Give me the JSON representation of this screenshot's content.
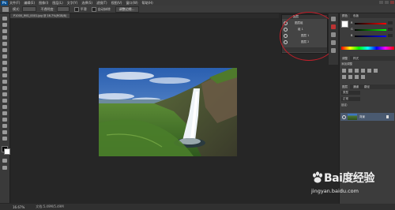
{
  "menubar": {
    "logo": "Ps",
    "items": [
      "文件(F)",
      "编辑(E)",
      "图像(I)",
      "图层(L)",
      "文字(Y)",
      "选择(S)",
      "滤镜(T)",
      "视图(V)",
      "窗口(W)",
      "帮助(H)"
    ]
  },
  "options": {
    "mode_label": "模式:",
    "mode_value": "正常",
    "opacity_label": "不透明度:",
    "opacity_value": "100%",
    "smooth_label": "平滑",
    "autoerase_label": "自动抹除",
    "button_label": "调整边缘..."
  },
  "document": {
    "tab_title": "P1000_IMG_0001.jpg @ 16.7%(RGB/8)",
    "zoom": "16.67%",
    "doc_info": "文档:5.49M/5.49M"
  },
  "flyout": {
    "tab_label": "图层",
    "rows": [
      "图层组",
      "组 1",
      "图层 1",
      "图层 2"
    ]
  },
  "panels": {
    "color_tabs": [
      "颜色",
      "色板"
    ],
    "slider_labels": [
      "R",
      "G",
      "B"
    ],
    "adjust_tabs": [
      "调整",
      "样式"
    ],
    "adjust_title": "添加调整",
    "layer_tabs": [
      "图层",
      "通道",
      "路径"
    ],
    "layer_kind": "类型",
    "layer_mode": "正常",
    "layer_lock": "锁定:",
    "layer_name": "背景"
  },
  "watermark": {
    "brand": "Bai度经验",
    "url": "jingyan.baidu.com"
  }
}
